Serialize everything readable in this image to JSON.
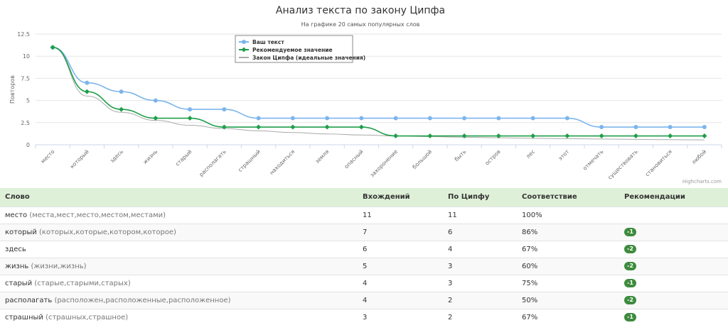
{
  "chart_data": {
    "type": "line",
    "title": "Анализ текста по закону Ципфа",
    "subtitle": "На графике 20 самых популярных слов",
    "ylabel": "Повторов",
    "xlabel": "",
    "ylim": [
      0,
      12.5
    ],
    "yticks": [
      "0",
      "2.5",
      "5",
      "7.5",
      "10",
      "12.5"
    ],
    "grid": true,
    "legend_position": "top",
    "credit": "Highcharts.com",
    "categories": [
      "место",
      "который",
      "здесь",
      "жизнь",
      "старый",
      "располагать",
      "страшный",
      "находиться",
      "земля",
      "опасный",
      "захоронение",
      "большой",
      "быть",
      "остров",
      "лес",
      "этот",
      "отмечать",
      "существовать",
      "становиться",
      "любой"
    ],
    "series": [
      {
        "name": "Ваш текст",
        "color": "#7cb5ec",
        "marker": "circle",
        "values": [
          11,
          7,
          6,
          5,
          4,
          4,
          3,
          3,
          3,
          3,
          3,
          3,
          3,
          3,
          3,
          3,
          2,
          2,
          2,
          2
        ]
      },
      {
        "name": "Рекомендуемое значение",
        "color": "#1f9e4a",
        "marker": "diamond",
        "values": [
          11,
          6,
          4,
          3,
          3,
          2,
          2,
          2,
          2,
          2,
          1,
          1,
          1,
          1,
          1,
          1,
          1,
          1,
          1,
          1
        ]
      },
      {
        "name": "Закон Ципфа (идеальные значения)",
        "color": "#aaaaaa",
        "marker": "none",
        "values": [
          11,
          5.5,
          3.67,
          2.75,
          2.2,
          1.83,
          1.57,
          1.38,
          1.22,
          1.1,
          1.0,
          0.92,
          0.85,
          0.79,
          0.73,
          0.69,
          0.65,
          0.61,
          0.58,
          0.55
        ]
      }
    ]
  },
  "table": {
    "headers": [
      "Слово",
      "Вхождений",
      "По Ципфу",
      "Соответствие",
      "Рекомендации"
    ],
    "rows": [
      {
        "word": "место",
        "forms": "(места,мест,место,местом,местами)",
        "count": "11",
        "zipf": "11",
        "match": "100%",
        "rec": ""
      },
      {
        "word": "который",
        "forms": "(которых,которые,котором,которое)",
        "count": "7",
        "zipf": "6",
        "match": "86%",
        "rec": "-1"
      },
      {
        "word": "здесь",
        "forms": "",
        "count": "6",
        "zipf": "4",
        "match": "67%",
        "rec": "-2"
      },
      {
        "word": "жизнь",
        "forms": "(жизни,жизнь)",
        "count": "5",
        "zipf": "3",
        "match": "60%",
        "rec": "-2"
      },
      {
        "word": "старый",
        "forms": "(старые,старыми,старых)",
        "count": "4",
        "zipf": "3",
        "match": "75%",
        "rec": "-1"
      },
      {
        "word": "располагать",
        "forms": "(расположен,расположенные,расположенное)",
        "count": "4",
        "zipf": "2",
        "match": "50%",
        "rec": "-2"
      },
      {
        "word": "страшный",
        "forms": "(страшных,страшное)",
        "count": "3",
        "zipf": "2",
        "match": "67%",
        "rec": "-1"
      }
    ]
  }
}
